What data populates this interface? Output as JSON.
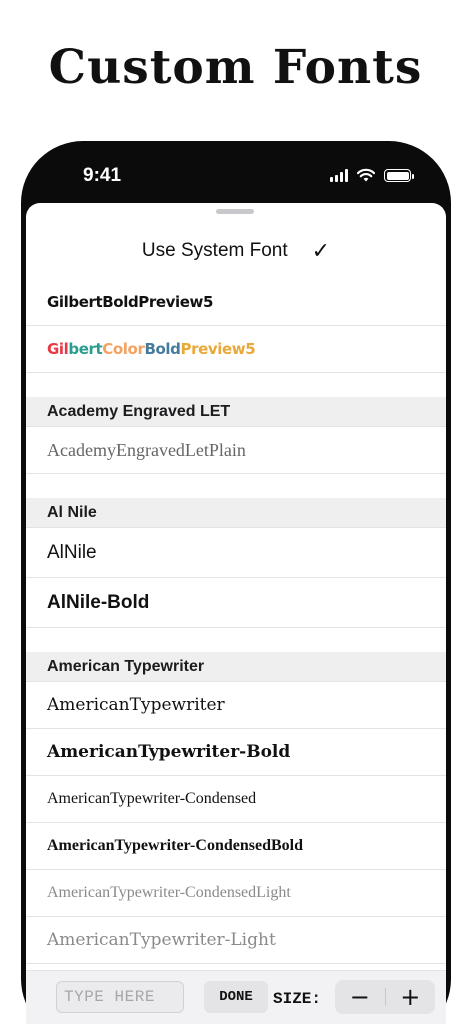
{
  "headline": "Custom Fonts",
  "status_bar": {
    "time": "9:41",
    "icons": [
      "cellular-signal-icon",
      "wifi-icon",
      "battery-icon"
    ]
  },
  "system_font": {
    "label": "Use System Font",
    "check": "✓"
  },
  "top_fonts": [
    "GilbertBoldPreview5"
  ],
  "gilbert_color": {
    "segments": [
      "Gil",
      "bert",
      "Color",
      "Bold",
      "Preview5"
    ],
    "colors": [
      "#e63946",
      "#2a9d8f",
      "#f4a261",
      "#457b9d",
      "#e9c46a"
    ]
  },
  "sections": [
    {
      "header": "Academy Engraved LET",
      "fonts": [
        "AcademyEngravedLetPlain"
      ]
    },
    {
      "header": "Al Nile",
      "fonts": [
        "AlNile",
        "AlNile-Bold"
      ]
    },
    {
      "header": "American Typewriter",
      "fonts": [
        "AmericanTypewriter",
        "AmericanTypewriter-Bold",
        "AmericanTypewriter-Condensed",
        "AmericanTypewriter-CondensedBold",
        "AmericanTypewriter-CondensedLight",
        "AmericanTypewriter-Light"
      ]
    }
  ],
  "toolbar": {
    "input_placeholder": "TYPE HERE",
    "done_label": "DONE",
    "size_label": "SIZE:",
    "minus": "−",
    "plus": "+"
  }
}
